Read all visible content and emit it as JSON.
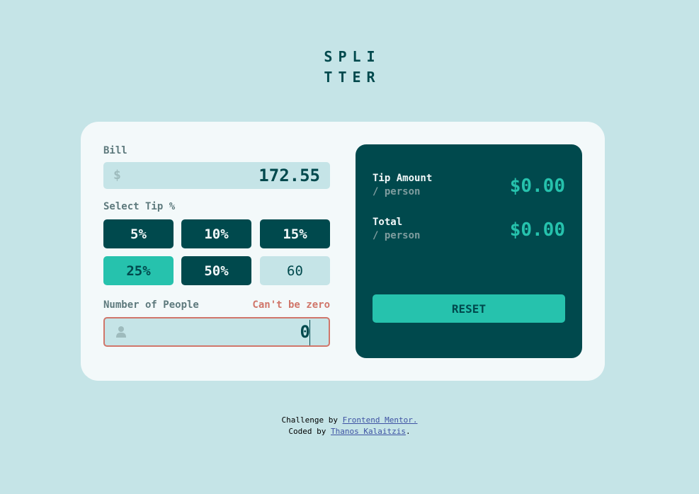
{
  "logo": {
    "line1": "SPLI",
    "line2": "TTER"
  },
  "form": {
    "bill_label": "Bill",
    "currency_symbol": "$",
    "bill_value": "172.55",
    "tip_label": "Select Tip %",
    "tips": [
      {
        "label": "5%",
        "active": false
      },
      {
        "label": "10%",
        "active": false
      },
      {
        "label": "15%",
        "active": false
      },
      {
        "label": "25%",
        "active": true
      },
      {
        "label": "50%",
        "active": false
      }
    ],
    "custom_tip_value": "60",
    "people_label": "Number of People",
    "people_error": "Can't be zero",
    "people_value": "0",
    "people_icon": "person-icon"
  },
  "results": {
    "tip_title": "Tip Amount",
    "tip_sub": "/ person",
    "tip_value": "$0.00",
    "total_title": "Total",
    "total_sub": "/ person",
    "total_value": "$0.00",
    "reset_label": "RESET"
  },
  "footer": {
    "line1_prefix": "Challenge by ",
    "line1_link": "Frontend Mentor.",
    "line2_prefix": "Coded by ",
    "line2_link": "Thanos Kalaitzis",
    "line2_suffix": "."
  },
  "colors": {
    "background": "#c5e4e7",
    "card": "#f3f9fa",
    "dark": "#00494d",
    "accent": "#26c2ad",
    "error": "#d0766a"
  }
}
